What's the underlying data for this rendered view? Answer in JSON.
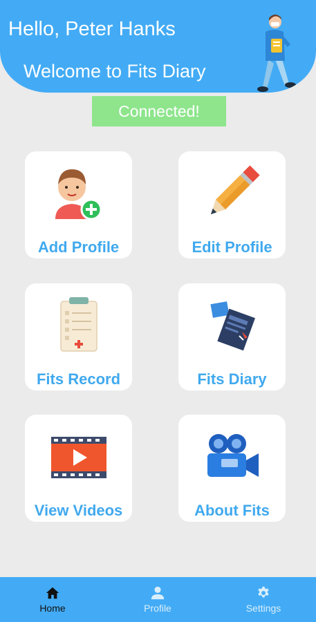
{
  "header": {
    "greeting": "Hello, Peter Hanks",
    "welcome": "Welcome to Fits Diary"
  },
  "status": {
    "text": "Connected!"
  },
  "menu": [
    {
      "label": "Add Profile",
      "icon": "add-user-icon"
    },
    {
      "label": "Edit Profile",
      "icon": "pencil-icon"
    },
    {
      "label": "Fits Record",
      "icon": "clipboard-icon"
    },
    {
      "label": "Fits Diary",
      "icon": "diary-icon"
    },
    {
      "label": "View Videos",
      "icon": "video-play-icon"
    },
    {
      "label": "About Fits",
      "icon": "video-camera-icon"
    }
  ],
  "nav": {
    "active": "Home",
    "items": [
      {
        "label": "Home",
        "icon": "home-icon"
      },
      {
        "label": "Profile",
        "icon": "person-icon"
      },
      {
        "label": "Settings",
        "icon": "gear-icon"
      }
    ]
  },
  "colors": {
    "primary": "#43abf5",
    "label": "#40a9ee",
    "status_bg": "#8ee58c",
    "background": "#ebebeb"
  }
}
